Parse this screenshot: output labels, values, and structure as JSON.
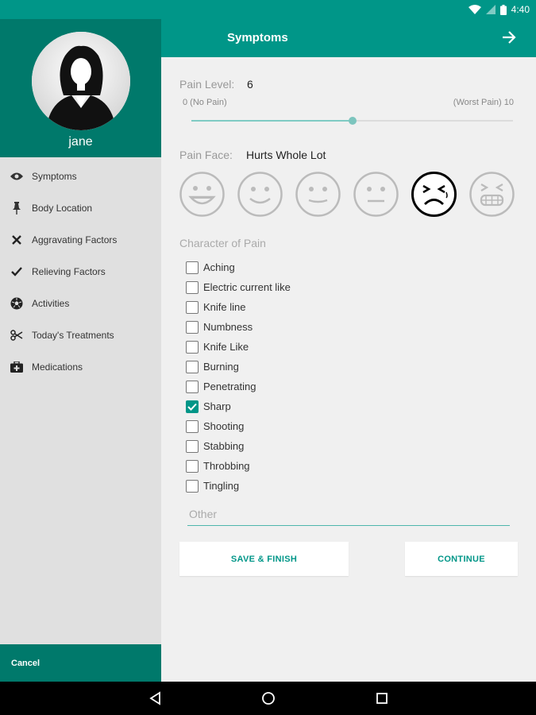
{
  "status_bar": {
    "time": "4:40",
    "icons": [
      "wifi-icon",
      "signal-icon",
      "battery-icon"
    ]
  },
  "sidebar": {
    "username": "jane",
    "items": [
      {
        "label": "Symptoms",
        "icon": "eye-icon"
      },
      {
        "label": "Body Location",
        "icon": "pin-icon"
      },
      {
        "label": "Aggravating Factors",
        "icon": "x-icon"
      },
      {
        "label": "Relieving Factors",
        "icon": "checkmark-icon"
      },
      {
        "label": "Activities",
        "icon": "soccer-ball-icon"
      },
      {
        "label": "Today's Treatments",
        "icon": "scissors-icon"
      },
      {
        "label": "Medications",
        "icon": "medical-kit-icon"
      }
    ],
    "cancel_label": "Cancel"
  },
  "appbar": {
    "title": "Symptoms",
    "next_icon": "arrow-right-icon"
  },
  "pain_level": {
    "label": "Pain Level:",
    "value": "6",
    "min_label": "0 (No Pain)",
    "max_label": "(Worst Pain) 10",
    "min": 0,
    "max": 10,
    "current": 6
  },
  "pain_face": {
    "label": "Pain Face:",
    "value": "Hurts Whole Lot",
    "faces": [
      "no-hurt-face-icon",
      "hurts-little-bit-face-icon",
      "hurts-little-more-face-icon",
      "hurts-even-more-face-icon",
      "hurts-whole-lot-face-icon",
      "hurts-worst-face-icon"
    ],
    "selected_index": 4
  },
  "character": {
    "label": "Character of Pain",
    "options": [
      {
        "label": "Aching",
        "checked": false
      },
      {
        "label": "Electric current like",
        "checked": false
      },
      {
        "label": "Knife line",
        "checked": false
      },
      {
        "label": "Numbness",
        "checked": false
      },
      {
        "label": "Knife Like",
        "checked": false
      },
      {
        "label": "Burning",
        "checked": false
      },
      {
        "label": "Penetrating",
        "checked": false
      },
      {
        "label": "Sharp",
        "checked": true
      },
      {
        "label": "Shooting",
        "checked": false
      },
      {
        "label": "Stabbing",
        "checked": false
      },
      {
        "label": "Throbbing",
        "checked": false
      },
      {
        "label": "Tingling",
        "checked": false
      }
    ],
    "other_placeholder": "Other",
    "other_value": ""
  },
  "actions": {
    "save_label": "SAVE & FINISH",
    "continue_label": "CONTINUE"
  },
  "colors": {
    "primary": "#009688",
    "primary_dark": "#00796b",
    "accent_light": "#80cbc4"
  }
}
